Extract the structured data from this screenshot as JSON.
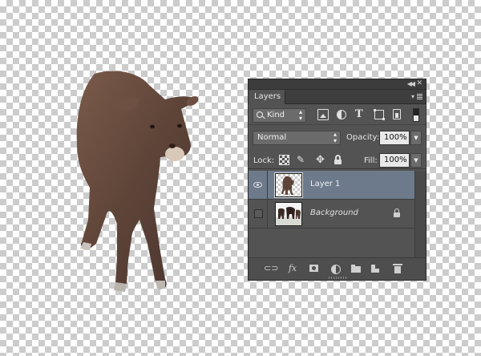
{
  "panel": {
    "tab_label": "Layers",
    "filter": {
      "kind_label": "Kind",
      "icons": [
        "image-filter-icon",
        "adjustment-filter-icon",
        "type-filter-icon",
        "shape-filter-icon",
        "smart-object-filter-icon"
      ],
      "type_glyph": "T"
    },
    "blend_mode": "Normal",
    "opacity_label": "Opacity:",
    "opacity_value": "100%",
    "lock_label": "Lock:",
    "fill_label": "Fill:",
    "fill_value": "100%",
    "layers": [
      {
        "name": "Layer 1",
        "visible": true,
        "selected": true
      },
      {
        "name": "Background",
        "visible": false,
        "selected": false,
        "locked": true
      }
    ],
    "footer_icons": [
      "link-icon",
      "fx-icon",
      "mask-icon",
      "adjustment-icon",
      "group-icon",
      "new-layer-icon",
      "trash-icon"
    ],
    "fx_glyph": "fx"
  },
  "colors": {
    "panel_bg": "#535353",
    "selected_layer": "#6d7a8c",
    "calf_body": "#5e4438"
  }
}
